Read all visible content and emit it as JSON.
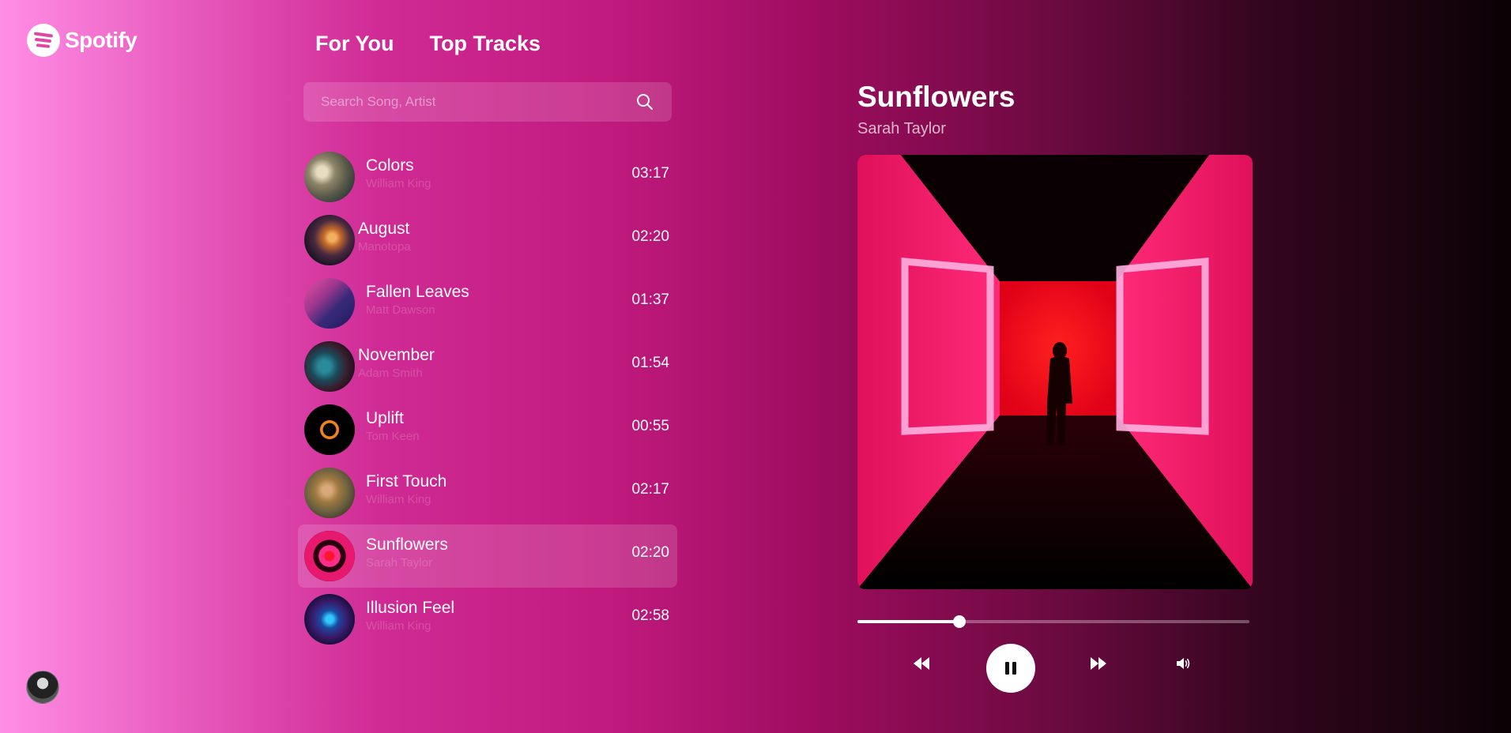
{
  "app": {
    "name": "Spotify"
  },
  "tabs": [
    {
      "label": "For You"
    },
    {
      "label": "Top Tracks"
    }
  ],
  "search": {
    "placeholder": "Search Song, Artist"
  },
  "tracks": [
    {
      "title": "Colors",
      "artist": "William King",
      "duration": "03:17"
    },
    {
      "title": "August",
      "artist": "Manotopa",
      "duration": "02:20"
    },
    {
      "title": "Fallen Leaves",
      "artist": "Matt Dawson",
      "duration": "01:37"
    },
    {
      "title": "November",
      "artist": "Adam Smith",
      "duration": "01:54"
    },
    {
      "title": "Uplift",
      "artist": "Tom Keen",
      "duration": "00:55"
    },
    {
      "title": "First Touch",
      "artist": "William King",
      "duration": "02:17"
    },
    {
      "title": "Sunflowers",
      "artist": "Sarah Taylor",
      "duration": "02:20",
      "active": true
    },
    {
      "title": "Illusion Feel",
      "artist": "William King",
      "duration": "02:58"
    }
  ],
  "now_playing": {
    "title": "Sunflowers",
    "artist": "Sarah Taylor",
    "progress": 0.26
  },
  "icons": [
    "spotify-logo-icon",
    "search-icon",
    "rewind-icon",
    "pause-icon",
    "fast-forward-icon",
    "volume-icon"
  ],
  "colors": {
    "accent": "#d02b95",
    "background_start": "#ff8ee6",
    "background_end": "#0a0205"
  }
}
